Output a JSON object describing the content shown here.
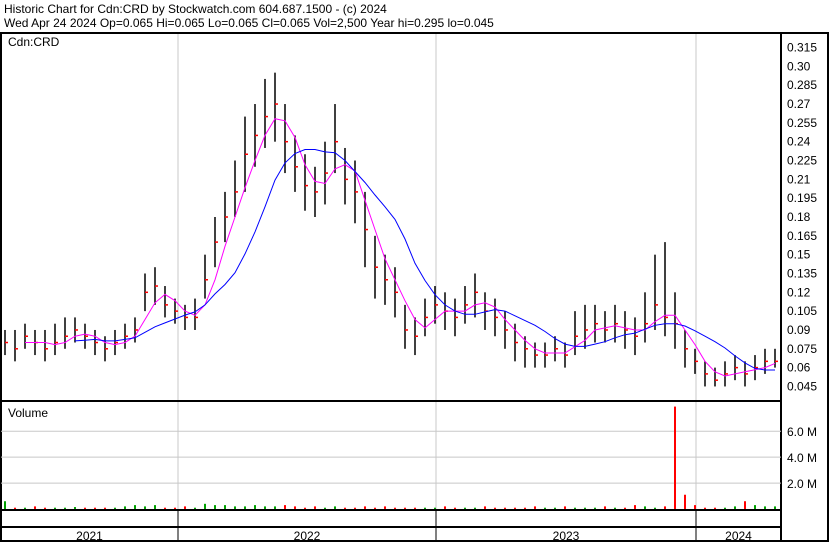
{
  "header": {
    "title": "Historic Chart for Cdn:CRD by Stockwatch.com 604.687.1500 - (c) 2024",
    "quote": "Wed Apr 24 2024  Op=0.065  Hi=0.065  Lo=0.065  Cl=0.065  Vol=2,500  Year hi=0.295  lo=0.045"
  },
  "chart_data": {
    "type": "ohlc-bar",
    "symbol_label": "Cdn:CRD",
    "volume_label": "Volume",
    "price_ticks": [
      "0.315",
      "0.30",
      "0.285",
      "0.27",
      "0.255",
      "0.24",
      "0.225",
      "0.21",
      "0.195",
      "0.18",
      "0.165",
      "0.15",
      "0.135",
      "0.12",
      "0.105",
      "0.09",
      "0.075",
      "0.06",
      "0.045"
    ],
    "price_range": [
      0.035,
      0.325
    ],
    "volume_ticks": [
      "6.0 M",
      "4.0 M",
      "2.0 M"
    ],
    "volume_tick_values": [
      6,
      4,
      2
    ],
    "volume_range": [
      0,
      8.1
    ],
    "years": [
      "2021",
      "2022",
      "2023",
      "2024"
    ],
    "year_boundaries": [
      17.3,
      43.1,
      69.1
    ],
    "ma_periods": [
      3,
      8
    ],
    "colors": {
      "up": "#00a000",
      "down": "#ff0000",
      "bar": "#000000",
      "ma_short": "#ff00ff",
      "ma_long": "#0000ff",
      "grid": "#c8c8c8"
    },
    "close": [
      0.08,
      0.075,
      0.085,
      0.08,
      0.075,
      0.08,
      0.085,
      0.09,
      0.085,
      0.08,
      0.075,
      0.08,
      0.085,
      0.09,
      0.12,
      0.125,
      0.11,
      0.105,
      0.1,
      0.1,
      0.13,
      0.16,
      0.18,
      0.2,
      0.23,
      0.245,
      0.26,
      0.27,
      0.24,
      0.22,
      0.205,
      0.2,
      0.215,
      0.24,
      0.21,
      0.2,
      0.17,
      0.14,
      0.13,
      0.12,
      0.09,
      0.085,
      0.1,
      0.11,
      0.105,
      0.1,
      0.11,
      0.12,
      0.105,
      0.1,
      0.09,
      0.08,
      0.075,
      0.07,
      0.07,
      0.075,
      0.07,
      0.085,
      0.09,
      0.095,
      0.09,
      0.095,
      0.09,
      0.085,
      0.095,
      0.11,
      0.1,
      0.095,
      0.075,
      0.065,
      0.055,
      0.05,
      0.055,
      0.06,
      0.055,
      0.06,
      0.065,
      0.065
    ],
    "high": [
      0.09,
      0.09,
      0.095,
      0.09,
      0.09,
      0.095,
      0.1,
      0.1,
      0.095,
      0.09,
      0.085,
      0.09,
      0.095,
      0.1,
      0.135,
      0.14,
      0.125,
      0.115,
      0.11,
      0.115,
      0.15,
      0.18,
      0.2,
      0.225,
      0.26,
      0.27,
      0.29,
      0.295,
      0.27,
      0.245,
      0.23,
      0.22,
      0.24,
      0.27,
      0.235,
      0.225,
      0.2,
      0.165,
      0.15,
      0.14,
      0.11,
      0.1,
      0.115,
      0.125,
      0.12,
      0.115,
      0.125,
      0.135,
      0.12,
      0.115,
      0.105,
      0.095,
      0.085,
      0.08,
      0.08,
      0.085,
      0.08,
      0.105,
      0.11,
      0.11,
      0.105,
      0.11,
      0.105,
      0.1,
      0.12,
      0.15,
      0.16,
      0.12,
      0.09,
      0.075,
      0.065,
      0.06,
      0.065,
      0.07,
      0.065,
      0.07,
      0.075,
      0.075
    ],
    "low": [
      0.07,
      0.065,
      0.075,
      0.07,
      0.065,
      0.07,
      0.075,
      0.08,
      0.075,
      0.07,
      0.065,
      0.07,
      0.075,
      0.08,
      0.105,
      0.11,
      0.1,
      0.095,
      0.09,
      0.09,
      0.115,
      0.14,
      0.16,
      0.18,
      0.2,
      0.22,
      0.235,
      0.24,
      0.215,
      0.2,
      0.185,
      0.18,
      0.19,
      0.215,
      0.19,
      0.175,
      0.14,
      0.115,
      0.11,
      0.1,
      0.075,
      0.07,
      0.085,
      0.095,
      0.09,
      0.085,
      0.095,
      0.1,
      0.09,
      0.085,
      0.075,
      0.065,
      0.06,
      0.06,
      0.06,
      0.065,
      0.06,
      0.07,
      0.075,
      0.08,
      0.08,
      0.08,
      0.075,
      0.07,
      0.08,
      0.09,
      0.085,
      0.075,
      0.06,
      0.055,
      0.045,
      0.045,
      0.045,
      0.05,
      0.045,
      0.05,
      0.055,
      0.06
    ],
    "volume": [
      0.6,
      0.1,
      0.1,
      0.2,
      0.1,
      0.1,
      0.1,
      0.15,
      0.1,
      0.1,
      0.1,
      0.1,
      0.2,
      0.3,
      0.2,
      0.3,
      0.1,
      0.1,
      0.2,
      0.1,
      0.4,
      0.3,
      0.3,
      0.2,
      0.2,
      0.3,
      0.2,
      0.2,
      0.3,
      0.2,
      0.1,
      0.2,
      0.1,
      0.2,
      0.1,
      0.1,
      0.2,
      0.1,
      0.2,
      0.1,
      0.1,
      0.1,
      0.1,
      0.1,
      0.2,
      0.1,
      0.1,
      0.1,
      0.2,
      0.1,
      0.1,
      0.1,
      0.1,
      0.2,
      0.1,
      0.1,
      0.2,
      0.1,
      0.1,
      0.1,
      0.2,
      0.1,
      0.1,
      0.3,
      0.2,
      0.1,
      0.2,
      7.9,
      1.1,
      0.3,
      0.1,
      0.1,
      0.1,
      0.2,
      0.6,
      0.3,
      0.2,
      0.2
    ]
  }
}
